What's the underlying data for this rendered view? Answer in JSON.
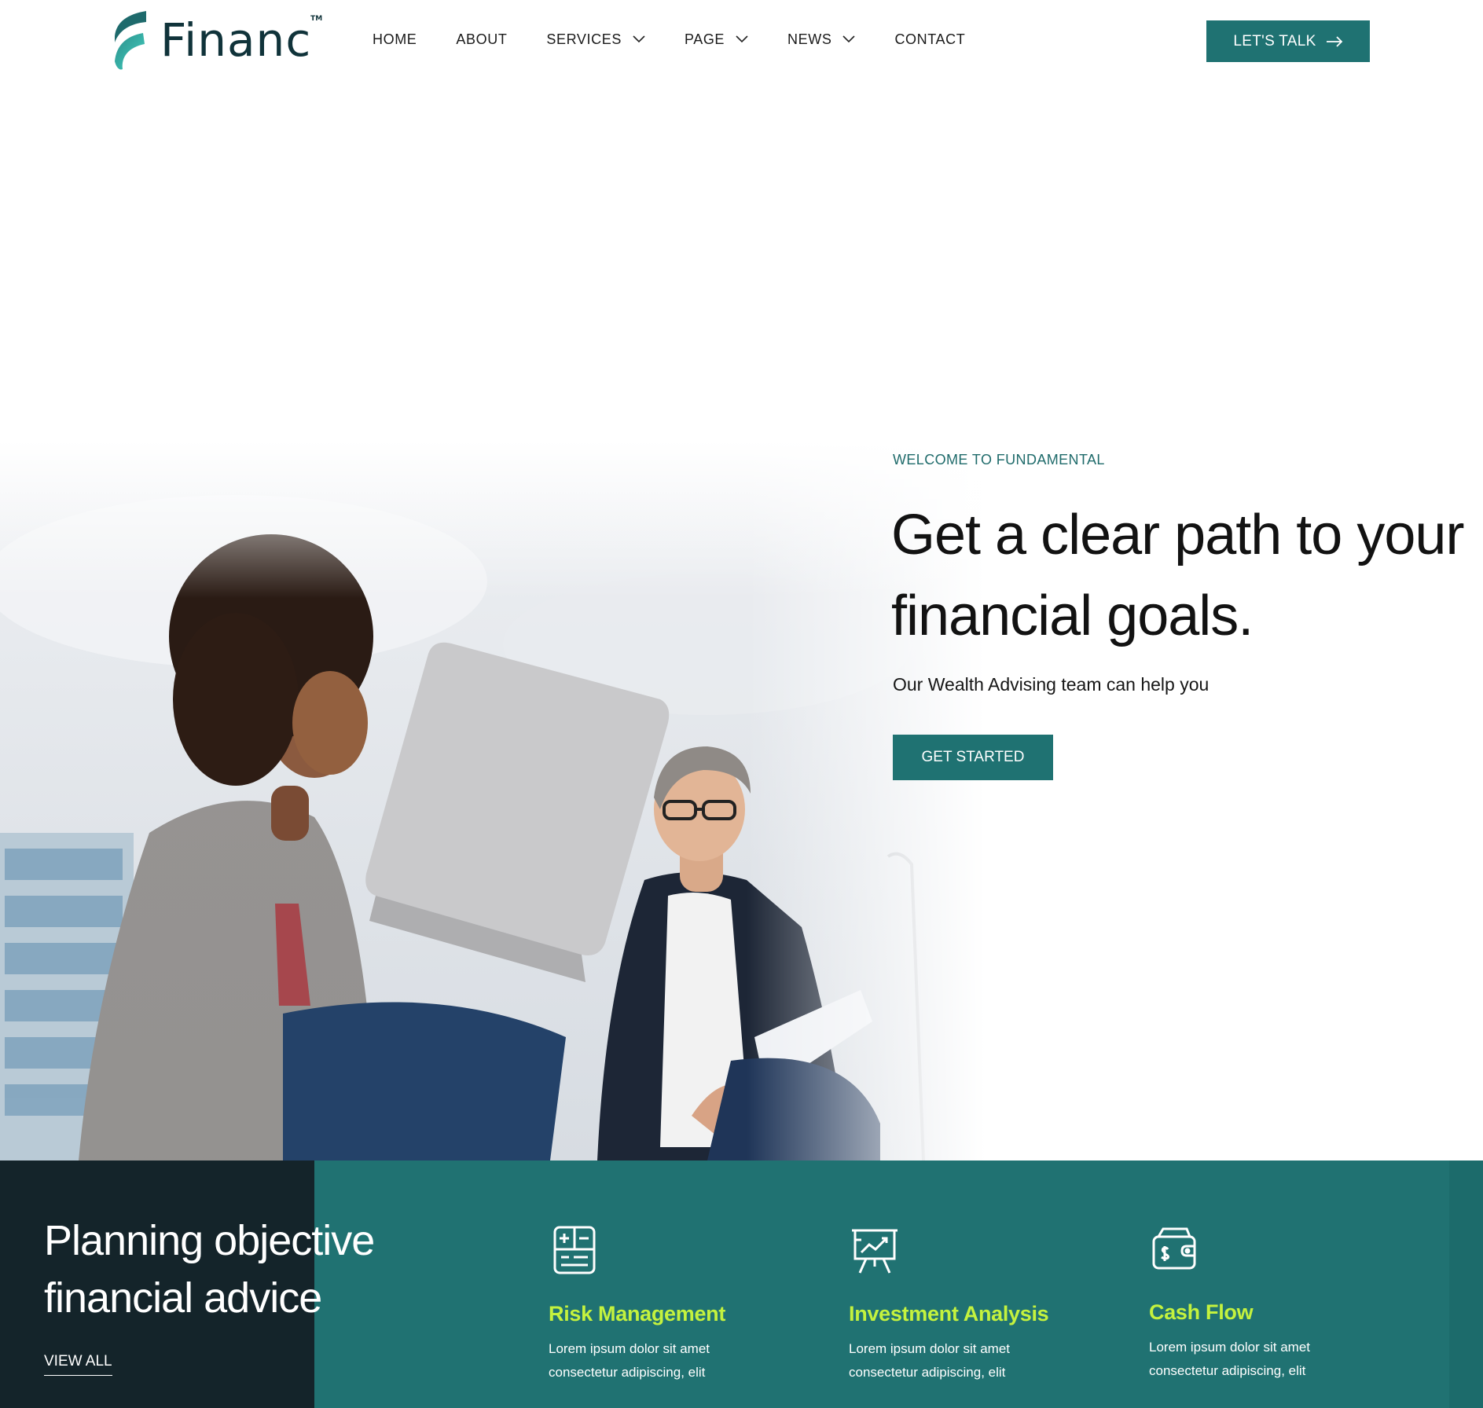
{
  "brand": {
    "name": "Financ",
    "tm": "TM"
  },
  "nav": {
    "items": [
      {
        "label": "HOME",
        "has_dropdown": false
      },
      {
        "label": "ABOUT",
        "has_dropdown": false
      },
      {
        "label": "SERVICES",
        "has_dropdown": true
      },
      {
        "label": "PAGE",
        "has_dropdown": true
      },
      {
        "label": "NEWS",
        "has_dropdown": true
      },
      {
        "label": "CONTACT",
        "has_dropdown": false
      }
    ],
    "cta_label": "LET'S TALK",
    "cta_icon": "arrow-right-icon"
  },
  "hero": {
    "kicker": "WELCOME TO FUNDAMENTAL",
    "title": "Get a clear path to your financial goals.",
    "subtitle": "Our Wealth Advising team can help you",
    "button_label": "GET STARTED"
  },
  "band": {
    "title": "Planning objective financial advice",
    "link_label": "VIEW ALL",
    "services": [
      {
        "icon": "calculator-list-icon",
        "title": "Risk Management",
        "text": "Lorem ipsum dolor sit amet consectetur adipiscing, elit"
      },
      {
        "icon": "presentation-chart-icon",
        "title": "Investment Analysis",
        "text": "Lorem ipsum dolor sit amet consectetur adipiscing, elit"
      },
      {
        "icon": "wallet-icon",
        "title": "Cash Flow",
        "text": "Lorem ipsum dolor sit amet consectetur adipiscing, elit"
      }
    ]
  },
  "colors": {
    "primary": "#1f7272",
    "dark": "#14242a",
    "accent": "#c4f23e",
    "logo_teal": "#2fb9ad",
    "logo_text": "#10333a"
  }
}
